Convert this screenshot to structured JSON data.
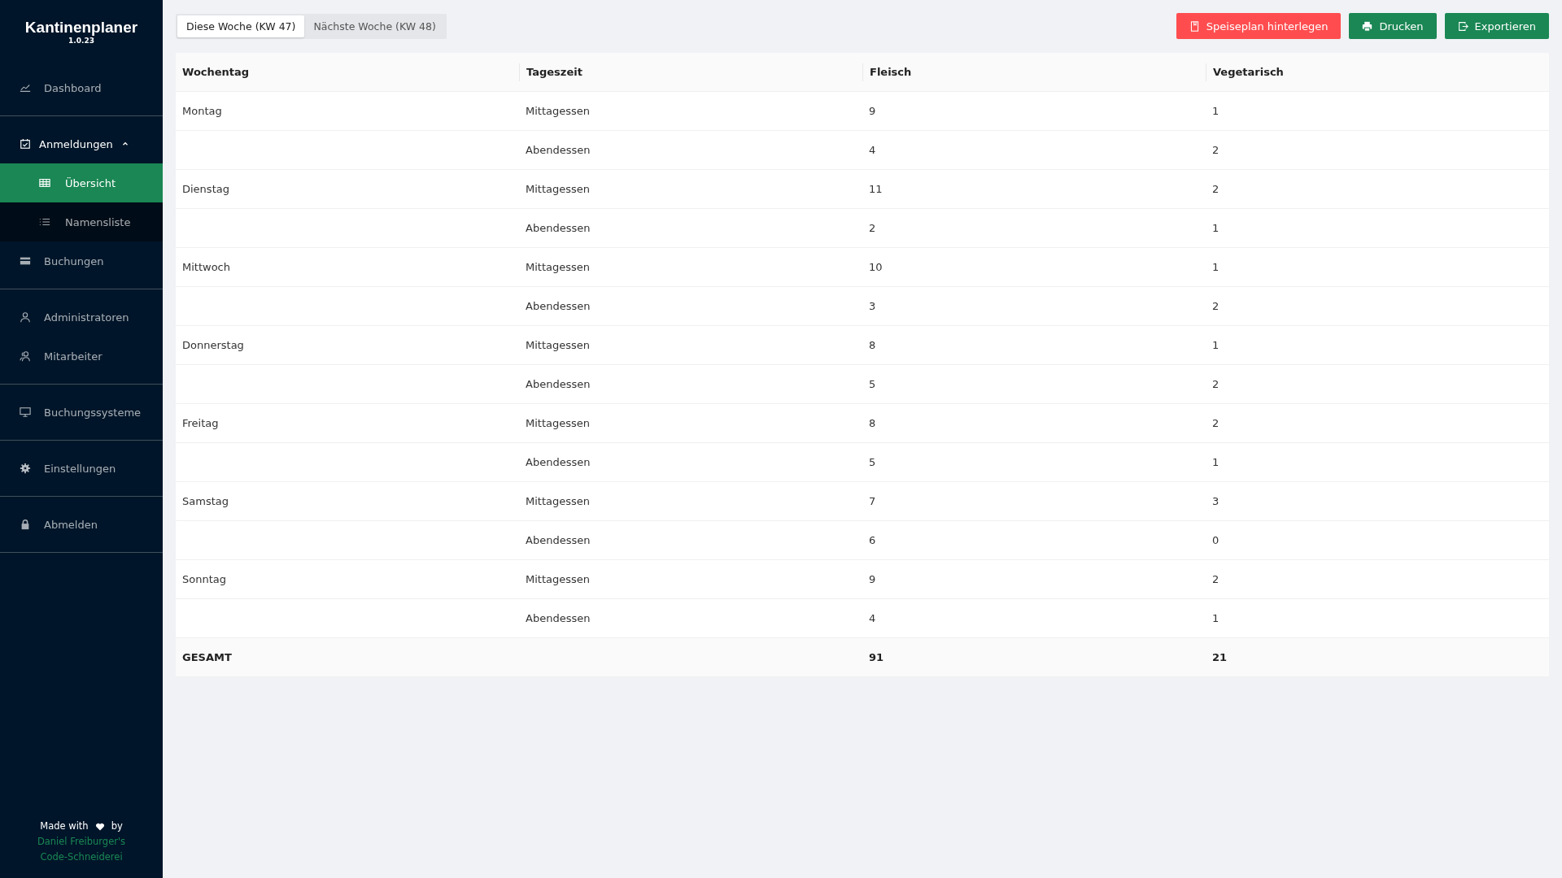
{
  "sidebar": {
    "logo": "Kantinenplaner",
    "version": "1.0.23",
    "groups": [
      {
        "items": [
          {
            "label": "Dashboard",
            "selected": false
          }
        ]
      },
      {
        "items": [
          {
            "label": "Anmeldungen",
            "selected": false,
            "expanded": true,
            "children": [
              {
                "label": "Übersicht",
                "selected": true
              },
              {
                "label": "Namensliste",
                "selected": false
              }
            ]
          },
          {
            "label": "Buchungen",
            "selected": false
          }
        ]
      },
      {
        "items": [
          {
            "label": "Administratoren",
            "selected": false
          },
          {
            "label": "Mitarbeiter",
            "selected": false
          }
        ]
      },
      {
        "items": [
          {
            "label": "Buchungssysteme",
            "selected": false
          }
        ]
      },
      {
        "items": [
          {
            "label": "Einstellungen",
            "selected": false
          }
        ]
      },
      {
        "items": [
          {
            "label": "Abmelden",
            "selected": false
          }
        ]
      }
    ],
    "footer": {
      "made_with": "Made with",
      "by": "by",
      "author_lines": [
        "Daniel Freiburger's",
        "Code-Schneiderei"
      ]
    }
  },
  "tabs": [
    {
      "label": "Diese Woche (KW 47)",
      "selected": true
    },
    {
      "label": "Nächste Woche (KW 48)",
      "selected": false
    }
  ],
  "buttons": [
    {
      "label": "Speiseplan hinterlegen",
      "kind": "danger"
    },
    {
      "label": "Drucken",
      "kind": "primary"
    },
    {
      "label": "Exportieren",
      "kind": "primary"
    }
  ],
  "table": {
    "columns": [
      "Wochentag",
      "Tageszeit",
      "Fleisch",
      "Vegetarisch"
    ],
    "rows": [
      {
        "day": "Montag",
        "meal": "Mittagessen",
        "meat": "9",
        "veg": "1"
      },
      {
        "meal": "Abendessen",
        "meat": "4",
        "veg": "2"
      },
      {
        "day": "Dienstag",
        "meal": "Mittagessen",
        "meat": "11",
        "veg": "2"
      },
      {
        "meal": "Abendessen",
        "meat": "2",
        "veg": "1"
      },
      {
        "day": "Mittwoch",
        "meal": "Mittagessen",
        "meat": "10",
        "veg": "1"
      },
      {
        "meal": "Abendessen",
        "meat": "3",
        "veg": "2"
      },
      {
        "day": "Donnerstag",
        "meal": "Mittagessen",
        "meat": "8",
        "veg": "1"
      },
      {
        "meal": "Abendessen",
        "meat": "5",
        "veg": "2"
      },
      {
        "day": "Freitag",
        "meal": "Mittagessen",
        "meat": "8",
        "veg": "2"
      },
      {
        "meal": "Abendessen",
        "meat": "5",
        "veg": "1"
      },
      {
        "day": "Samstag",
        "meal": "Mittagessen",
        "meat": "7",
        "veg": "3"
      },
      {
        "meal": "Abendessen",
        "meat": "6",
        "veg": "0"
      },
      {
        "day": "Sonntag",
        "meal": "Mittagessen",
        "meat": "9",
        "veg": "2"
      },
      {
        "meal": "Abendessen",
        "meat": "4",
        "veg": "1"
      }
    ],
    "total": {
      "label": "GESAMT",
      "meat": "91",
      "veg": "21"
    }
  }
}
